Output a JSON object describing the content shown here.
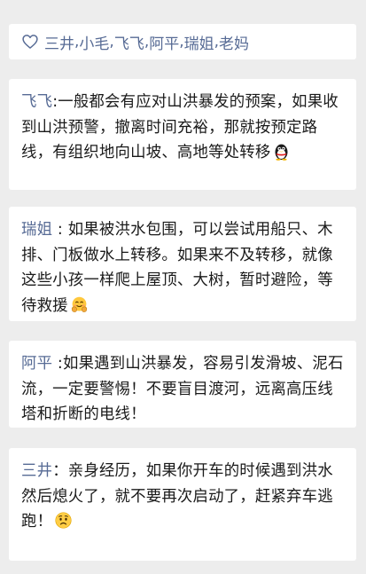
{
  "likes": {
    "icon": "heart-outline-icon",
    "names": [
      "三井",
      "小毛",
      "飞飞",
      "阿平",
      "瑞姐",
      "老妈"
    ],
    "separator": ","
  },
  "comments": [
    {
      "author": "飞飞",
      "separator": ":",
      "text": "一般都会有应对山洪暴发的预案，如果收到山洪预警，撤离时间充裕，那就按预定路线，有组织地向山坡、高地等处转移",
      "emoji": "penguin-emoji"
    },
    {
      "author": "瑞姐",
      "separator": " : ",
      "text": "如果被洪水包围，可以尝试用船只、木排、门板做水上转移。如果来不及转移，就像这些小孩一样爬上屋顶、大树，暂时避险，等待救援",
      "emoji": "hugging-face-emoji"
    },
    {
      "author": "阿平",
      "separator": " :",
      "text": "如果遇到山洪暴发，容易引发滑坡、泥石流，一定要警惕！不要盲目渡河，远离高压线塔和折断的电线！",
      "emoji": ""
    },
    {
      "author": "三井",
      "separator": "：",
      "text": "亲身经历，如果你开车的时候遇到洪水然后熄火了，就不要再次启动了，赶紧弃车逃跑！",
      "emoji": "worried-face-emoji"
    }
  ],
  "colors": {
    "name": "#576b95",
    "text": "#1a1a1a",
    "background": "#ededed",
    "card": "#ffffff"
  }
}
